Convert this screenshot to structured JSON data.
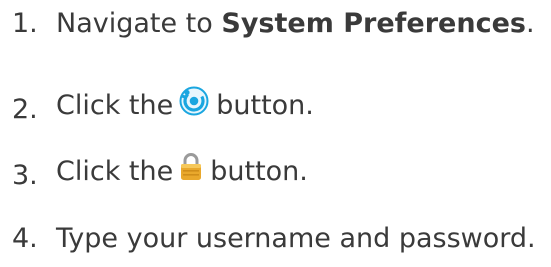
{
  "steps": [
    {
      "number": "1.",
      "text_before": "Navigate to ",
      "bold": "System Preferences",
      "text_after": "."
    },
    {
      "number": "2.",
      "text_before": "Click the",
      "icon": "network-utility-icon",
      "text_after": "button."
    },
    {
      "number": "3.",
      "text_before": "Click the",
      "icon": "padlock-icon",
      "text_after": "button."
    },
    {
      "number": "4.",
      "text": "Type your username and password."
    }
  ],
  "colors": {
    "text": "#3a3a3a",
    "network_icon": "#1aa6e0",
    "padlock_body": "#e9a82c",
    "padlock_shackle": "#9a9a9a"
  }
}
